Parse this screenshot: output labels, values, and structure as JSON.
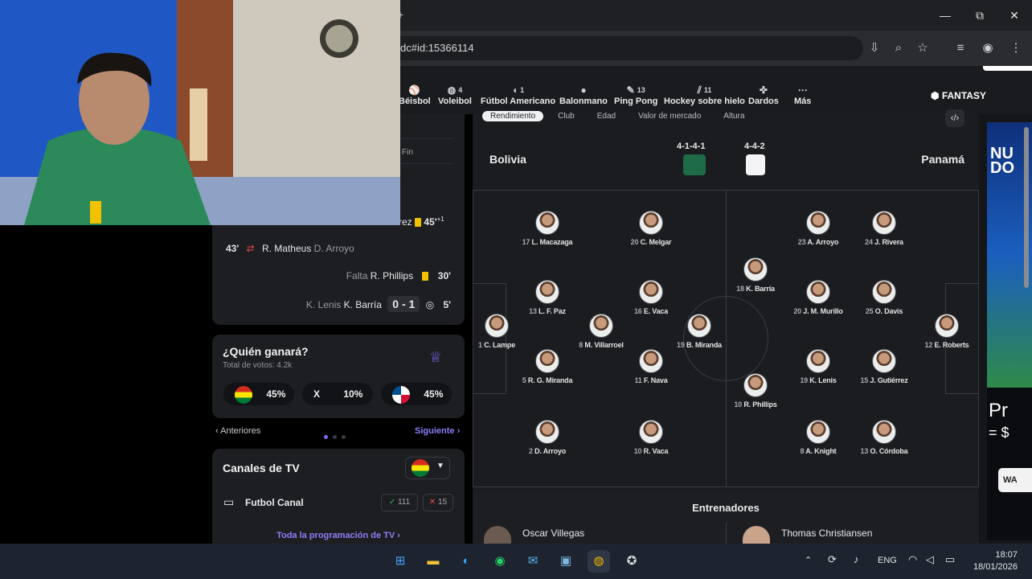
{
  "browser": {
    "url": "dc#id:15366114",
    "controls": {
      "minimize": "—",
      "maximize": "⧉",
      "close": "✕"
    }
  },
  "sports_nav": [
    {
      "label": "Béisbol",
      "count": "",
      "icon": "baseball-icon"
    },
    {
      "label": "Voleibol",
      "count": "4",
      "icon": "volleyball-icon"
    },
    {
      "label": "Fútbol Americano",
      "count": "1",
      "icon": "football-icon"
    },
    {
      "label": "Balonmano",
      "count": "",
      "icon": "handball-icon"
    },
    {
      "label": "Ping Pong",
      "count": "13",
      "icon": "ping-pong-icon"
    },
    {
      "label": "Hockey sobre hielo",
      "count": "11",
      "icon": "hockey-icon"
    },
    {
      "label": "Dardos",
      "count": "",
      "icon": "darts-icon"
    },
    {
      "label": "Más",
      "count": "",
      "icon": "more-icon"
    }
  ],
  "fantasy_label": "FANTASY",
  "filter_tabs": [
    "Rendimiento",
    "Club",
    "Edad",
    "Valor de mercado",
    "Altura"
  ],
  "timeline": {
    "end_label": "Fin",
    "partial_event": {
      "name": "rez",
      "minute": "45'",
      "extra": "+1"
    },
    "events": [
      {
        "minute": "43'",
        "player_in": "R. Matheus",
        "player_out": "D. Arroyo"
      },
      {
        "type": "Falta",
        "player": "R. Phillips",
        "minute": "30'"
      },
      {
        "assist": "K. Lenis",
        "player": "K. Barría",
        "score": "0 - 1",
        "minute": "5'"
      }
    ]
  },
  "poll": {
    "title": "¿Quién ganará?",
    "subtitle": "Total de votos: 4.2k",
    "home_pct": "45%",
    "draw_label": "X",
    "draw_pct": "10%",
    "away_pct": "45%",
    "prev_label": "Anteriores",
    "next_label": "Siguiente"
  },
  "tv": {
    "title": "Canales de TV",
    "channel": "Futbol Canal",
    "upvotes": "111",
    "downvotes": "15",
    "all_link": "Toda la programación de TV"
  },
  "lineup": {
    "home_team": "Bolivia",
    "away_team": "Panamá",
    "home_formation": "4-1-4-1",
    "away_formation": "4-4-2",
    "home_players": [
      {
        "num": "17",
        "name": "L. Macazaga"
      },
      {
        "num": "20",
        "name": "C. Melgar"
      },
      {
        "num": "13",
        "name": "L. F. Paz"
      },
      {
        "num": "16",
        "name": "E. Vaca"
      },
      {
        "num": "1",
        "name": "C. Lampe"
      },
      {
        "num": "8",
        "name": "M. Villarroel"
      },
      {
        "num": "19",
        "name": "B. Miranda"
      },
      {
        "num": "5",
        "name": "R. G. Miranda"
      },
      {
        "num": "11",
        "name": "F. Nava"
      },
      {
        "num": "2",
        "name": "D. Arroyo"
      },
      {
        "num": "10",
        "name": "R. Vaca"
      }
    ],
    "away_players": [
      {
        "num": "23",
        "name": "A. Arroyo"
      },
      {
        "num": "24",
        "name": "J. Rivera"
      },
      {
        "num": "18",
        "name": "K. Barría"
      },
      {
        "num": "20",
        "name": "J. M. Murillo"
      },
      {
        "num": "25",
        "name": "O. Davis"
      },
      {
        "num": "12",
        "name": "E. Roberts"
      },
      {
        "num": "19",
        "name": "K. Lenis"
      },
      {
        "num": "15",
        "name": "J. Gutiérrez"
      },
      {
        "num": "10",
        "name": "R. Phillips"
      },
      {
        "num": "8",
        "name": "A. Knight"
      },
      {
        "num": "13",
        "name": "O. Córdoba"
      }
    ],
    "coaches_title": "Entrenadores",
    "home_coach": "Oscar Villegas",
    "away_coach": "Thomas Christiansen"
  },
  "ad": {
    "text1": "NU",
    "text2": "DO",
    "text3": "Pr",
    "text4": "= $",
    "btn": "WA"
  },
  "taskbar": {
    "lang": "ENG",
    "time": "18:07",
    "date": "18/01/2026"
  },
  "colors": {
    "accent": "#7b6cf6",
    "yellow_card": "#f2c200",
    "bg": "#1b1c1f"
  }
}
